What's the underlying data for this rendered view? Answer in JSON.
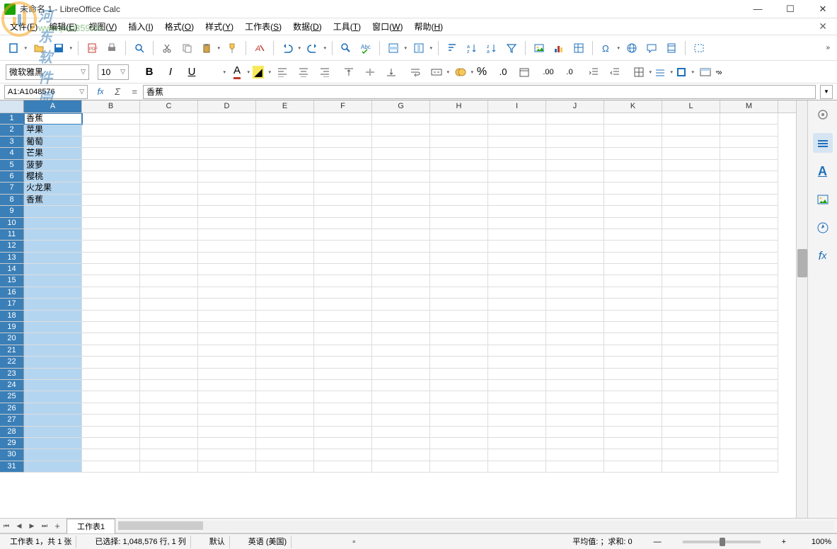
{
  "watermark": {
    "text": "河东软件园",
    "url": "www.pc0359.cn"
  },
  "title": "未命名 1 - LibreOffice Calc",
  "menus": [
    {
      "label": "文件",
      "accel": "F"
    },
    {
      "label": "编辑",
      "accel": "E"
    },
    {
      "label": "视图",
      "accel": "V"
    },
    {
      "label": "插入",
      "accel": "I"
    },
    {
      "label": "格式",
      "accel": "O"
    },
    {
      "label": "样式",
      "accel": "Y"
    },
    {
      "label": "工作表",
      "accel": "S"
    },
    {
      "label": "数据",
      "accel": "D"
    },
    {
      "label": "工具",
      "accel": "T"
    },
    {
      "label": "窗口",
      "accel": "W"
    },
    {
      "label": "帮助",
      "accel": "H"
    }
  ],
  "font": {
    "name": "微软雅黑",
    "size": "10"
  },
  "nameBox": "A1:A1048576",
  "formulaInput": "香蕉",
  "columns": [
    "A",
    "B",
    "C",
    "D",
    "E",
    "F",
    "G",
    "H",
    "I",
    "J",
    "K",
    "L",
    "M"
  ],
  "colWidths": {
    "default": 82,
    "A": 82
  },
  "rowCount": 31,
  "cells": {
    "A1": "香蕉",
    "A2": "苹果",
    "A3": "葡萄",
    "A4": "芒果",
    "A5": "菠萝",
    "A6": "樱桃",
    "A7": "火龙果",
    "A8": "香蕉"
  },
  "selectedColumn": "A",
  "activeCell": "A1",
  "sheetTab": "工作表1",
  "status": {
    "sheetInfo": "工作表 1，共 1 张",
    "selection": "已选择: 1,048,576 行, 1 列",
    "default": "默认",
    "language": "英语 (美国)",
    "summary": "平均值: ；求和: 0",
    "zoom": "100%"
  }
}
